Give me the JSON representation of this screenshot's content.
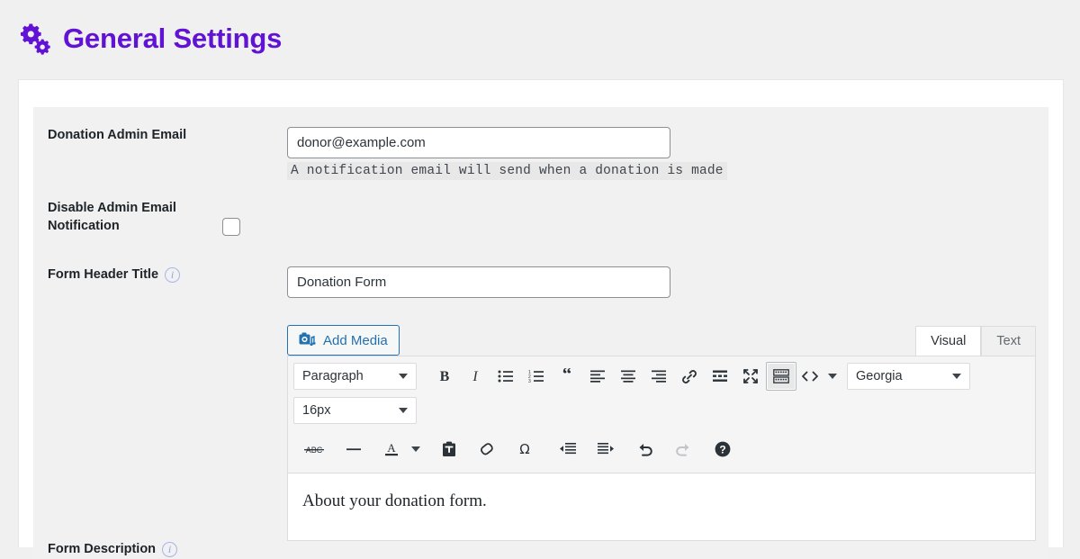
{
  "page": {
    "title": "General Settings",
    "title_color": "#6112d4",
    "icon": "gears-icon"
  },
  "form": {
    "rows": [
      {
        "label": "Donation Admin Email",
        "has_info": false,
        "value": "donor@example.com",
        "help": "A notification email will send when a donation is made"
      },
      {
        "label": "Disable Admin Email Notification",
        "has_info": false,
        "checked": false
      },
      {
        "label": "Form Header Title",
        "has_info": true,
        "value": "Donation Form"
      },
      {
        "label": "Form Description",
        "has_info": true
      }
    ]
  },
  "editor": {
    "add_media_label": "Add Media",
    "add_media_icon": "media-camera-music-icon",
    "tabs": [
      {
        "label": "Visual",
        "active": true
      },
      {
        "label": "Text",
        "active": false
      }
    ],
    "toolbar_row1": {
      "paragraph_select": "Paragraph",
      "font_family_select": "Georgia",
      "buttons": [
        {
          "name": "bold-icon",
          "title": "Bold"
        },
        {
          "name": "italic-icon",
          "title": "Italic"
        },
        {
          "name": "bulleted-list-icon",
          "title": "Bulleted list"
        },
        {
          "name": "numbered-list-icon",
          "title": "Numbered list"
        },
        {
          "name": "blockquote-icon",
          "title": "Blockquote"
        },
        {
          "name": "align-left-icon",
          "title": "Align left"
        },
        {
          "name": "align-center-icon",
          "title": "Align center"
        },
        {
          "name": "align-right-icon",
          "title": "Align right"
        },
        {
          "name": "link-icon",
          "title": "Insert/edit link"
        },
        {
          "name": "read-more-icon",
          "title": "Insert Read More tag"
        },
        {
          "name": "fullscreen-icon",
          "title": "Distraction-free writing mode"
        },
        {
          "name": "toolbar-toggle-icon",
          "title": "Toolbar Toggle",
          "active": true
        },
        {
          "name": "source-code-icon",
          "title": "Source code"
        }
      ]
    },
    "toolbar_row2": {
      "font_size_select": "16px",
      "buttons": [
        {
          "name": "strikethrough-icon",
          "title": "Strikethrough",
          "glyph": "ABC"
        },
        {
          "name": "horizontal-rule-icon",
          "title": "Horizontal line"
        },
        {
          "name": "text-color-icon",
          "title": "Text color"
        },
        {
          "name": "paste-as-text-icon",
          "title": "Paste as text"
        },
        {
          "name": "clear-formatting-icon",
          "title": "Clear formatting"
        },
        {
          "name": "special-character-icon",
          "title": "Special character",
          "glyph": "Ω"
        },
        {
          "name": "outdent-icon",
          "title": "Decrease indent"
        },
        {
          "name": "indent-icon",
          "title": "Increase indent"
        },
        {
          "name": "undo-icon",
          "title": "Undo"
        },
        {
          "name": "redo-icon",
          "title": "Redo",
          "disabled": true
        },
        {
          "name": "help-icon",
          "title": "Keyboard Shortcuts"
        }
      ]
    },
    "content": "About your donation form."
  }
}
